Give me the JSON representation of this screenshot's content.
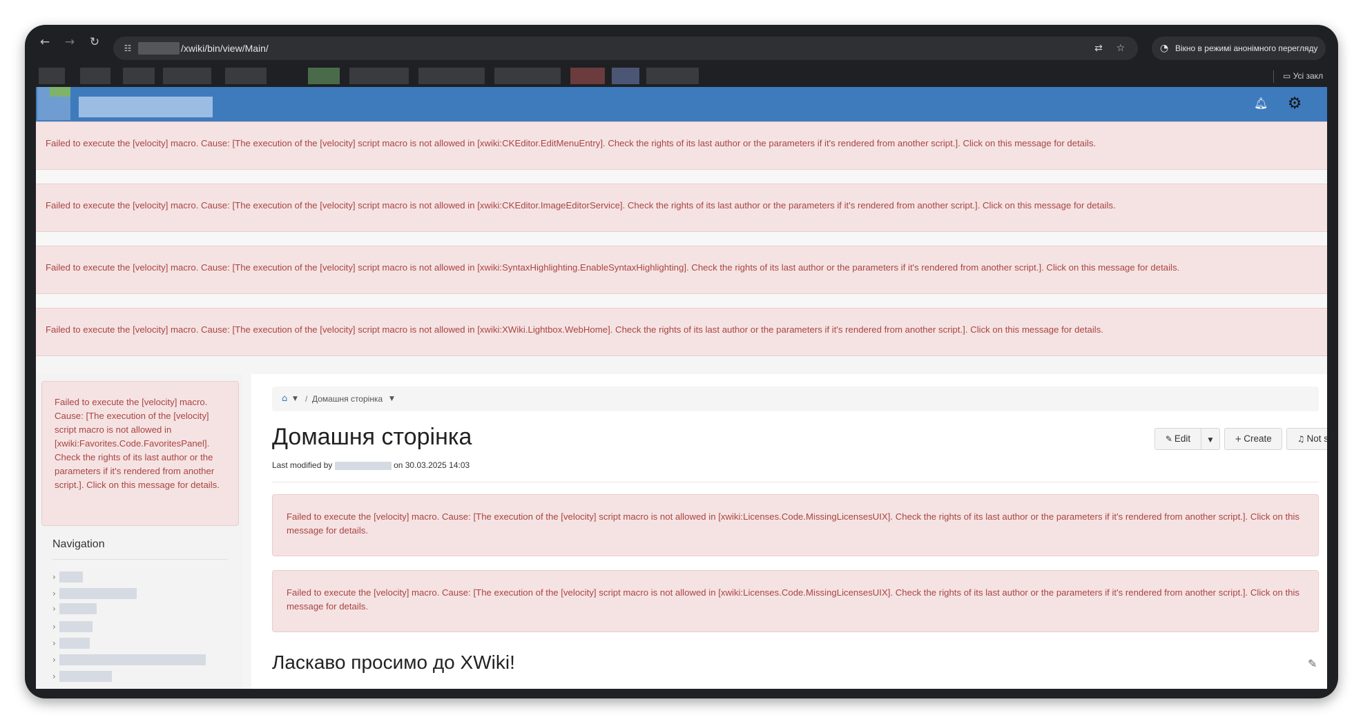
{
  "browser": {
    "url_path": "/xwiki/bin/view/Main/",
    "incognito_label": "Вікно в режимі анонімного перегляду",
    "bookmarks_folder_label": "Усі закл"
  },
  "errors": {
    "top": [
      "Failed to execute the [velocity] macro. Cause: [The execution of the [velocity] script macro is not allowed in [xwiki:CKEditor.EditMenuEntry]. Check the rights of its last author or the parameters if it's rendered from another script.]. Click on this message for details.",
      "Failed to execute the [velocity] macro. Cause: [The execution of the [velocity] script macro is not allowed in [xwiki:CKEditor.ImageEditorService]. Check the rights of its last author or the parameters if it's rendered from another script.]. Click on this message for details.",
      "Failed to execute the [velocity] macro. Cause: [The execution of the [velocity] script macro is not allowed in [xwiki:SyntaxHighlighting.EnableSyntaxHighlighting]. Check the rights of its last author or the parameters if it's rendered from another script.]. Click on this message for details.",
      "Failed to execute the [velocity] macro. Cause: [The execution of the [velocity] script macro is not allowed in [xwiki:XWiki.Lightbox.WebHome]. Check the rights of its last author or the parameters if it's rendered from another script.]. Click on this message for details."
    ],
    "panel": "Failed to execute the [velocity] macro. Cause: [The execution of the [velocity] script macro is not allowed in [xwiki:Favorites.Code.FavoritesPanel]. Check the rights of its last author or the parameters if it's rendered from another script.]. Click on this message for details.",
    "main": [
      "Failed to execute the [velocity] macro. Cause: [The execution of the [velocity] script macro is not allowed in [xwiki:Licenses.Code.MissingLicensesUIX]. Check the rights of its last author or the parameters if it's rendered from another script.]. Click on this message for details.",
      "Failed to execute the [velocity] macro. Cause: [The execution of the [velocity] script macro is not allowed in [xwiki:Licenses.Code.MissingLicensesUIX]. Check the rights of its last author or the parameters if it's rendered from another script.]. Click on this message for details."
    ]
  },
  "sidebar": {
    "navigation_title": "Navigation"
  },
  "page": {
    "breadcrumb_page": "Домашня сторінка",
    "breadcrumb_sep": "/",
    "title": "Домашня сторінка",
    "modified_prefix": "Last modified by",
    "modified_suffix": "on 30.03.2025 14:03",
    "welcome_heading": "Ласкаво просимо до XWiki!"
  },
  "actions": {
    "edit": "Edit",
    "create": "Create",
    "notify": "Not set"
  },
  "colors": {
    "header_blue": "#3e7bbd",
    "error_bg": "#f5e3e3",
    "error_text": "#a94442"
  }
}
